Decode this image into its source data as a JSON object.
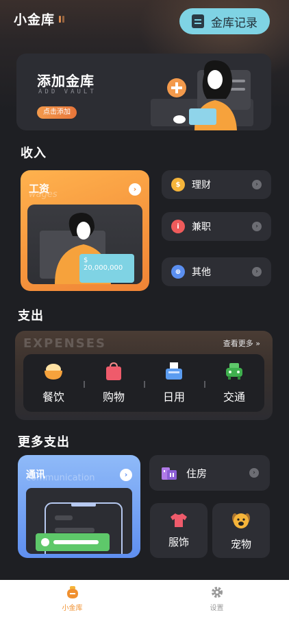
{
  "header": {
    "app_title": "小金库",
    "record_button": "金库记录"
  },
  "vault_banner": {
    "title": "添加金库",
    "subtitle": "ADD VAULT",
    "action": "点击添加"
  },
  "income": {
    "section_title": "收入",
    "salary": {
      "label": "工资",
      "ghost": "wages",
      "amount": "20,000,000",
      "currency": "$"
    },
    "items": [
      {
        "label": "理财",
        "icon": "coin-icon",
        "color": "#f5b43a"
      },
      {
        "label": "兼职",
        "icon": "part-time-icon",
        "color": "#ef5b5b"
      },
      {
        "label": "其他",
        "icon": "other-icon",
        "color": "#5b8ff0"
      }
    ]
  },
  "expenses": {
    "section_title": "支出",
    "banner_text": "EXPENSES",
    "more_link": "查看更多",
    "items": [
      {
        "label": "餐饮",
        "icon": "food-bowl-icon"
      },
      {
        "label": "购物",
        "icon": "shopping-bag-icon"
      },
      {
        "label": "日用",
        "icon": "daily-goods-icon"
      },
      {
        "label": "交通",
        "icon": "car-icon"
      }
    ]
  },
  "more_expenses": {
    "section_title": "更多支出",
    "communication": {
      "label": "通讯",
      "ghost": "communication"
    },
    "housing": {
      "label": "住房"
    },
    "clothing": {
      "label": "服饰"
    },
    "pets": {
      "label": "宠物"
    }
  },
  "tabbar": {
    "tabs": [
      {
        "label": "小金库",
        "icon": "vault-icon",
        "active": true
      },
      {
        "label": "设置",
        "icon": "settings-gear-icon",
        "active": false
      }
    ]
  },
  "colors": {
    "accent": "#f0902f",
    "cyan": "#7fd3e4",
    "card": "#2d2e34",
    "background": "#1e1f23"
  }
}
